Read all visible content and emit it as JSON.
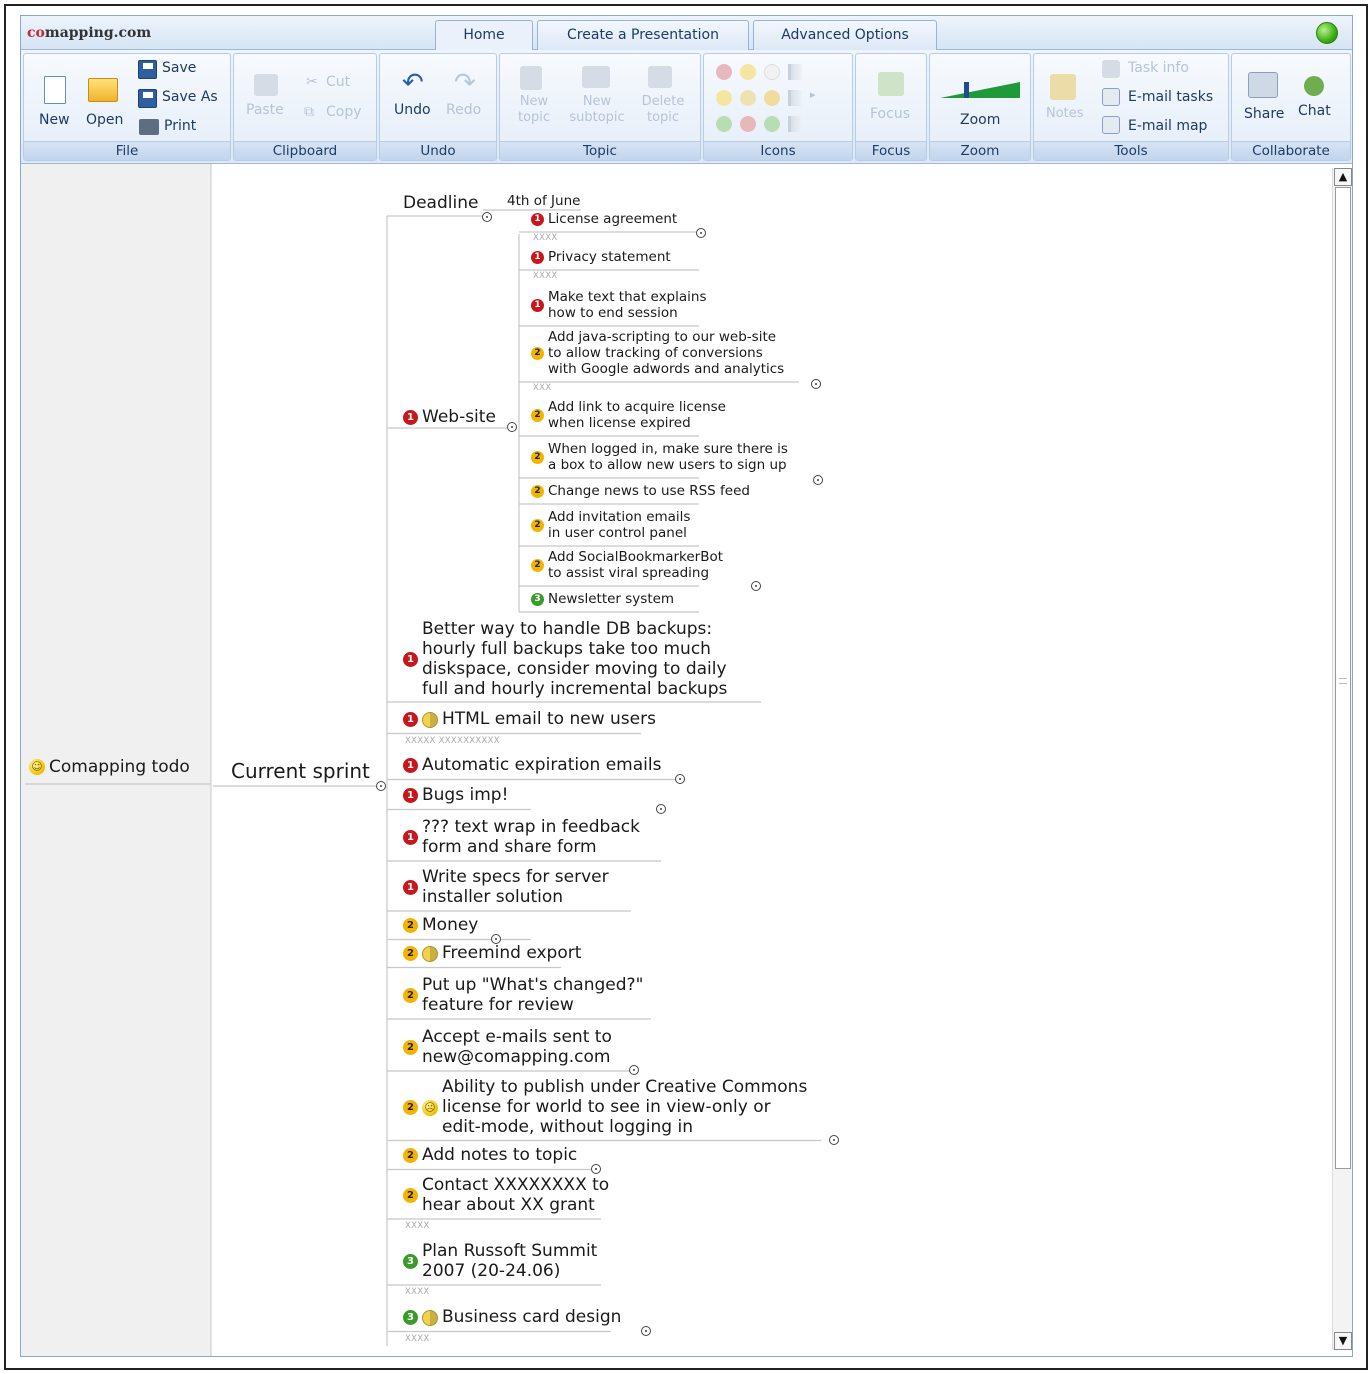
{
  "brand": {
    "prefix": "co",
    "rest": "mapping.com"
  },
  "tabs": [
    "Home",
    "Create a Presentation",
    "Advanced Options"
  ],
  "ribbon": {
    "file": {
      "caption": "File",
      "new": "New",
      "open": "Open",
      "save": "Save",
      "save_as": "Save As",
      "print": "Print"
    },
    "clipboard": {
      "caption": "Clipboard",
      "paste": "Paste",
      "cut": "Cut",
      "copy": "Copy"
    },
    "undo": {
      "caption": "Undo",
      "undo": "Undo",
      "redo": "Redo"
    },
    "topic": {
      "caption": "Topic",
      "new_topic": "New topic",
      "new_subtopic": "New subtopic",
      "delete_topic": "Delete topic"
    },
    "icons": {
      "caption": "Icons"
    },
    "focus": {
      "caption": "Focus",
      "focus": "Focus"
    },
    "zoom": {
      "caption": "Zoom",
      "zoom": "Zoom"
    },
    "tools": {
      "caption": "Tools",
      "notes": "Notes",
      "task_info": "Task info",
      "email_tasks": "E-mail tasks",
      "email_map": "E-mail map"
    },
    "collaborate": {
      "caption": "Collaborate",
      "share": "Share",
      "chat": "Chat"
    }
  },
  "map": {
    "root": "Comapping todo",
    "sprint": "Current sprint",
    "deadline": "Deadline",
    "deadline_value": "4th of June",
    "website": "Web-site",
    "website_children": [
      {
        "p": "1",
        "lines": [
          "License agreement"
        ],
        "note": "XXXX"
      },
      {
        "p": "1",
        "lines": [
          "Privacy statement"
        ],
        "note": "XXXX"
      },
      {
        "p": "1",
        "lines": [
          "Make text that explains",
          "how to end session"
        ]
      },
      {
        "p": "2",
        "lines": [
          "Add java-scripting to our web-site",
          "to allow tracking of conversions",
          "with Google adwords and analytics"
        ],
        "note": "XXX"
      },
      {
        "p": "2",
        "lines": [
          "Add link to acquire license",
          "when license expired"
        ]
      },
      {
        "p": "2",
        "lines": [
          "When logged in, make sure there is",
          "a box to allow new users to sign up"
        ]
      },
      {
        "p": "2",
        "lines": [
          "Change news to use RSS feed"
        ]
      },
      {
        "p": "2",
        "lines": [
          "Add invitation emails",
          "in user control panel"
        ]
      },
      {
        "p": "2",
        "lines": [
          "Add SocialBookmarkerBot",
          "to assist viral spreading"
        ]
      },
      {
        "p": "3",
        "lines": [
          "Newsletter system"
        ]
      }
    ],
    "tasks": [
      {
        "p": "1",
        "lines": [
          "Better way to handle DB backups:",
          "hourly full backups take too much",
          "diskspace, consider moving to daily",
          "full and hourly incremental backups"
        ]
      },
      {
        "p": "1",
        "extra": "half",
        "lines": [
          "HTML email to new users"
        ],
        "note": "XXXXX XXXXXXXXXX"
      },
      {
        "p": "1",
        "lines": [
          "Automatic expiration emails"
        ]
      },
      {
        "p": "1",
        "lines": [
          "Bugs imp!"
        ]
      },
      {
        "p": "1",
        "lines": [
          "??? text wrap in feedback",
          "form and share form"
        ]
      },
      {
        "p": "1",
        "lines": [
          "Write specs for server",
          "installer solution"
        ]
      },
      {
        "p": "2",
        "lines": [
          "Money"
        ]
      },
      {
        "p": "2",
        "extra": "half",
        "lines": [
          "Freemind export"
        ]
      },
      {
        "p": "2",
        "lines": [
          "Put up \"What's changed?\"",
          "feature for review"
        ]
      },
      {
        "p": "2",
        "lines": [
          "Accept e-mails sent to",
          "new@comapping.com"
        ]
      },
      {
        "p": "2",
        "extra": "sad",
        "lines": [
          "Ability to publish under Creative Commons",
          "license for world to see in view-only or",
          "edit-mode, without logging in"
        ]
      },
      {
        "p": "2",
        "lines": [
          "Add notes to topic"
        ]
      },
      {
        "p": "2",
        "lines": [
          "Contact XXXXXXXX to",
          "hear about XX grant"
        ],
        "note": "XXXX"
      },
      {
        "p": "3",
        "lines": [
          "Plan Russoft Summit",
          "2007 (20-24.06)"
        ],
        "note": "XXXX"
      },
      {
        "p": "3",
        "extra": "half",
        "lines": [
          "Business card design"
        ],
        "note": "XXXX"
      }
    ]
  }
}
